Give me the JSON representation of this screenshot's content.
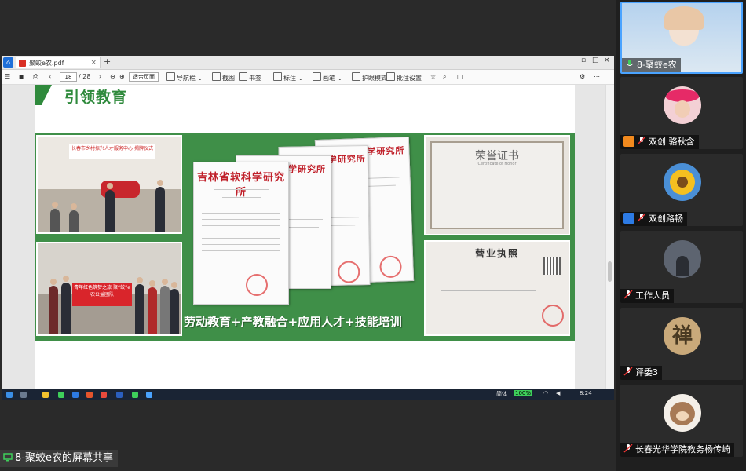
{
  "app": {
    "share_label": "8-聚蛟e农的屏幕共享"
  },
  "pdf": {
    "tab_title": "聚蛟e农.pdf",
    "page_current": "18",
    "page_total": "/ 28",
    "zoom": "适合页面",
    "toolbar": [
      {
        "name": "sidebar",
        "label": "导航栏"
      },
      {
        "name": "screenshot",
        "label": "截图"
      },
      {
        "name": "bookmark",
        "label": "书签"
      },
      {
        "name": "annotate",
        "label": "标注"
      },
      {
        "name": "draw",
        "label": "画笔"
      },
      {
        "name": "eye-care",
        "label": "护眼模式"
      },
      {
        "name": "batch-settings",
        "label": "批注设置"
      }
    ],
    "slide": {
      "title": "引领教育",
      "slogan": "劳动教育+产教融合+应用人才+技能培训",
      "doc_header": "吉林省软科学研究所",
      "cert_title": "荣誉证书",
      "cert_subtitle": "Certificate of Honor",
      "license_title": "营业执照",
      "photo1_banner": "长春市乡村振兴人才服务中心 揭牌仪式",
      "photo2_banner": "青年红色筑梦之旅 聚“蛟”e农公益团队"
    }
  },
  "taskbar": {
    "battery": "100%",
    "ime": "简体",
    "time": "8:24"
  },
  "participants": [
    {
      "name": "8-聚蛟e农",
      "active": true
    },
    {
      "name": "双创 骆秋含",
      "active": false
    },
    {
      "name": "双创路畅",
      "active": false
    },
    {
      "name": "工作人员",
      "active": false
    },
    {
      "name": "评委3",
      "active": false,
      "avatar_glyph": "禅"
    },
    {
      "name": "长春光华学院教务杨传崎",
      "active": false
    }
  ],
  "colors": {
    "slide_green": "#3f8f48",
    "title_green": "#2f8a3c",
    "active_border": "#4aa3ff",
    "mic_green": "#3ecf5b"
  }
}
